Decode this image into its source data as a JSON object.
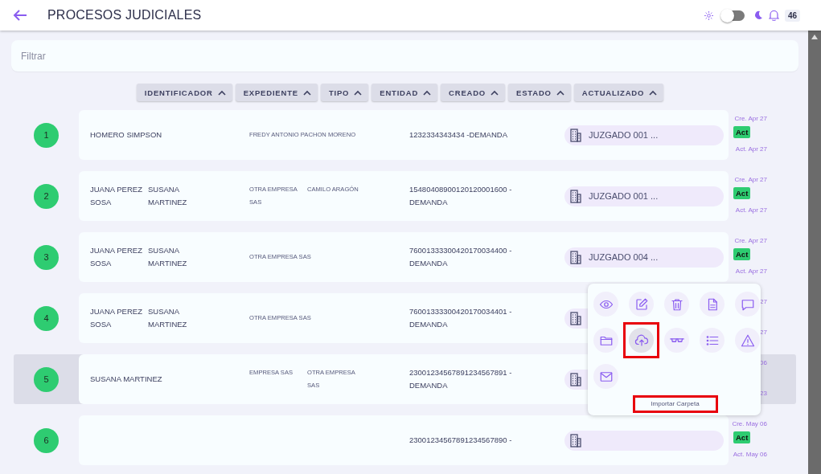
{
  "header": {
    "title": "PROCESOS JUDICIALES",
    "dark_mode": false,
    "notifications": "46"
  },
  "filter": {
    "placeholder": "Filtrar"
  },
  "sort_columns": [
    "IDENTIFICADOR",
    "EXPEDIENTE",
    "TIPO",
    "ENTIDAD",
    "CREADO",
    "ESTADO",
    "ACTUALIZADO"
  ],
  "rows": [
    {
      "number": "1",
      "names": [
        "HOMERO SIMPSON"
      ],
      "parties": [
        "FREDY ANTONIO PACHON MORENO"
      ],
      "case_number": "1232334343434 -DEMANDA",
      "court": "JUZGADO 001 ...",
      "created": "Cre. Apr 27",
      "status": "Act",
      "updated": "Act. Apr 27",
      "selected": false
    },
    {
      "number": "2",
      "names": [
        "JUANA PEREZ SOSA",
        "SUSANA MARTINEZ"
      ],
      "parties": [
        "OTRA EMPRESA SAS",
        "CAMILO ARAGÓN"
      ],
      "case_number": "15480408900120120001600 - DEMANDA",
      "court": "JUZGADO 001 ...",
      "created": "Cre. Apr 27",
      "status": "Act",
      "updated": "Act. Apr 27",
      "selected": false
    },
    {
      "number": "3",
      "names": [
        "JUANA PEREZ SOSA",
        "SUSANA MARTINEZ"
      ],
      "parties": [
        "OTRA EMPRESA SAS"
      ],
      "case_number": "76001333300420170034400 - DEMANDA",
      "court": "JUZGADO 004 ...",
      "created": "Cre. Apr 27",
      "status": "Act",
      "updated": "Act. Apr 27",
      "selected": false
    },
    {
      "number": "4",
      "names": [
        "JUANA PEREZ SOSA",
        "SUSANA MARTINEZ"
      ],
      "parties": [
        "OTRA EMPRESA SAS"
      ],
      "case_number": "76001333300420170034401 - DEMANDA",
      "created": "27",
      "updated": "27",
      "selected": false
    },
    {
      "number": "5",
      "names": [
        "SUSANA MARTINEZ"
      ],
      "parties": [
        "EMPRESA SAS",
        "OTRA EMPRESA SAS"
      ],
      "case_number": "23001234567891234567891 - DEMANDA",
      "created": "06",
      "updated": "23",
      "selected": true
    },
    {
      "number": "6",
      "case_number": "23001234567891234567890 -",
      "created": "Cre. May 06",
      "status": "Act",
      "updated": "Act. May 06",
      "selected": false
    }
  ],
  "action_menu": {
    "actions": [
      {
        "kind": "eye",
        "selected": false
      },
      {
        "kind": "edit",
        "selected": false
      },
      {
        "kind": "trash",
        "selected": false
      },
      {
        "kind": "document",
        "selected": false
      },
      {
        "kind": "chat",
        "selected": false
      },
      {
        "kind": "folder",
        "selected": false
      },
      {
        "kind": "upload",
        "selected": true
      },
      {
        "kind": "glasses",
        "selected": false
      },
      {
        "kind": "list",
        "selected": false
      },
      {
        "kind": "warning",
        "selected": false
      },
      {
        "kind": "mail",
        "selected": false
      }
    ],
    "tooltip": "Importar Carpeta"
  }
}
